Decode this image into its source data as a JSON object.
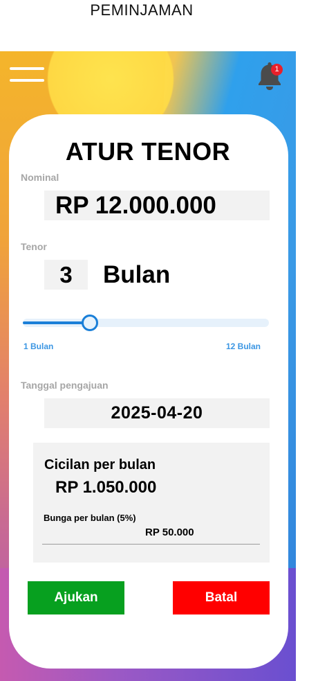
{
  "app": {
    "title": "PEMINJAMAN"
  },
  "header": {
    "notification_count": "1",
    "menu_icon": "hamburger-menu-icon",
    "bell_icon": "bell-icon"
  },
  "form": {
    "heading": "ATUR TENOR",
    "nominal_label": "Nominal",
    "nominal_value": "RP 12.000.000",
    "tenor_label": "Tenor",
    "tenor_value": "3",
    "tenor_unit": "Bulan",
    "slider": {
      "min_label": "1 Bulan",
      "max_label": "12 Bulan",
      "min": 1,
      "max": 12,
      "value": 3
    },
    "date_label": "Tanggal pengajuan",
    "date_value": "2025-04-20"
  },
  "summary": {
    "cicilan_label": "Cicilan per bulan",
    "cicilan_value": "RP 1.050.000",
    "bunga_label": "Bunga per bulan (5%)",
    "bunga_value": "RP 50.000"
  },
  "actions": {
    "submit_label": "Ajukan",
    "cancel_label": "Batal"
  },
  "colors": {
    "accent": "#1a7fd8",
    "submit": "#07a01f",
    "cancel": "#ff0000",
    "badge": "#e8202a"
  }
}
